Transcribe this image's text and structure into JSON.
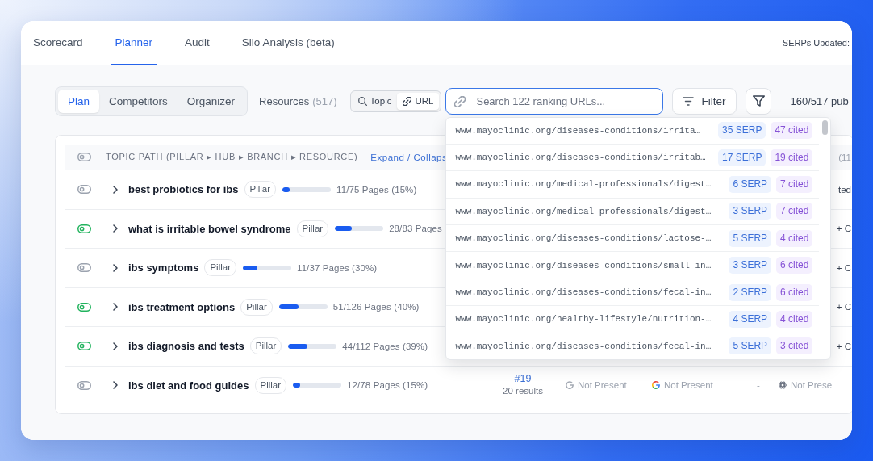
{
  "tabs": [
    {
      "label": "Scorecard",
      "selected": false
    },
    {
      "label": "Planner",
      "selected": true
    },
    {
      "label": "Audit",
      "selected": false
    },
    {
      "label": "Silo Analysis (beta)",
      "selected": false
    }
  ],
  "serps_updated": "SERPs Updated:",
  "toolbar": {
    "views": [
      {
        "label": "Plan",
        "selected": true
      },
      {
        "label": "Competitors",
        "selected": false
      },
      {
        "label": "Organizer",
        "selected": false
      }
    ],
    "resources": {
      "label": "Resources",
      "count": "(517)"
    },
    "search_modes": [
      {
        "label": "Topic",
        "selected": false
      },
      {
        "label": "URL",
        "selected": true
      }
    ],
    "search": {
      "placeholder": "Search 122 ranking URLs...",
      "results": [
        {
          "url": "www.mayoclinic.org/diseases-conditions/irrita…",
          "serp": "35 SERP",
          "cited": "47 cited"
        },
        {
          "url": "www.mayoclinic.org/diseases-conditions/irritab…",
          "serp": "17 SERP",
          "cited": "19 cited"
        },
        {
          "url": "www.mayoclinic.org/medical-professionals/digest…",
          "serp": "6 SERP",
          "cited": "7 cited"
        },
        {
          "url": "www.mayoclinic.org/medical-professionals/digest…",
          "serp": "3 SERP",
          "cited": "7 cited"
        },
        {
          "url": "www.mayoclinic.org/diseases-conditions/lactose-…",
          "serp": "5 SERP",
          "cited": "4 cited"
        },
        {
          "url": "www.mayoclinic.org/diseases-conditions/small-in…",
          "serp": "3 SERP",
          "cited": "6 cited"
        },
        {
          "url": "www.mayoclinic.org/diseases-conditions/fecal-in…",
          "serp": "2 SERP",
          "cited": "6 cited"
        },
        {
          "url": "www.mayoclinic.org/healthy-lifestyle/nutrition-…",
          "serp": "4 SERP",
          "cited": "4 cited"
        },
        {
          "url": "www.mayoclinic.org/diseases-conditions/fecal-in…",
          "serp": "5 SERP",
          "cited": "3 cited"
        }
      ]
    },
    "filter": "Filter",
    "published": "160/517 pub"
  },
  "table": {
    "header": {
      "on": false,
      "label": "TOPIC PATH (PILLAR ▸ HUB ▸ BRANCH ▸ RESOURCE)",
      "link": "Expand / Collaps",
      "column_7": "(11"
    },
    "rows": [
      {
        "on": false,
        "title": "best probiotics for ibs",
        "tag": "Pillar",
        "level": 0.15,
        "pages": "11/75 Pages (15%)",
        "cells": [
          {
            "kind": "fragment",
            "text": "ted"
          }
        ]
      },
      {
        "on": true,
        "title": "what is irritable bowel syndrome",
        "tag": "Pillar",
        "level": 0.34,
        "pages": "28/83 Pages",
        "cells": [
          {
            "kind": "fragment",
            "text": "+ C"
          }
        ]
      },
      {
        "on": false,
        "title": "ibs symptoms",
        "tag": "Pillar",
        "level": 0.3,
        "pages": "11/37 Pages (30%)",
        "cells": [
          {
            "kind": "fragment",
            "text": "+ C"
          }
        ]
      },
      {
        "on": true,
        "title": "ibs treatment options",
        "tag": "Pillar",
        "level": 0.4,
        "pages": "51/126 Pages (40%)",
        "cells": [
          {
            "kind": "fragment",
            "text": "+ C"
          }
        ]
      },
      {
        "on": true,
        "title": "ibs diagnosis and tests",
        "tag": "Pillar",
        "level": 0.39,
        "pages": "44/112 Pages (39%)",
        "cells": [
          {
            "kind": "fragment",
            "text": "+ C"
          }
        ]
      },
      {
        "on": false,
        "title": "ibs diet and food guides",
        "tag": "Pillar",
        "level": 0.15,
        "pages": "12/78 Pages (15%)",
        "cells": [
          {
            "kind": "rank",
            "text": "#19",
            "note": "20 results"
          },
          {
            "kind": "status",
            "text": "Not Present"
          },
          {
            "kind": "status",
            "text": "Not Present"
          },
          {
            "kind": "empty",
            "text": "-"
          },
          {
            "kind": "status",
            "text": "Not Prese"
          }
        ]
      }
    ]
  }
}
